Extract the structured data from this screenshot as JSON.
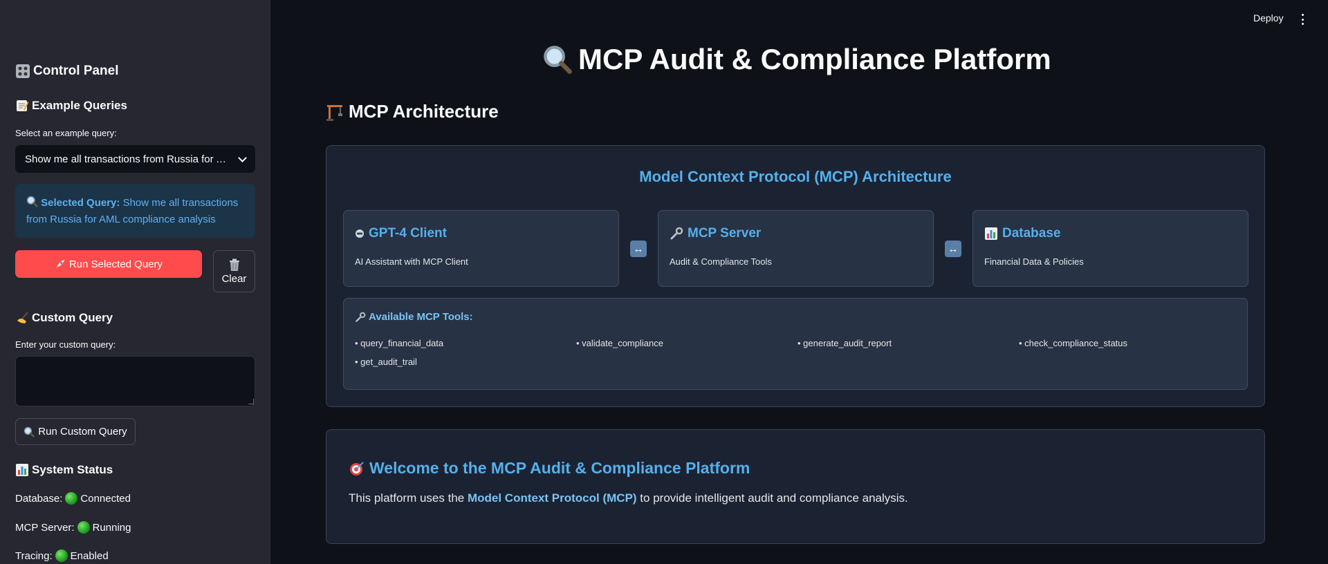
{
  "header": {
    "deploy_label": "Deploy"
  },
  "sidebar": {
    "control_panel_title": "Control Panel",
    "example_queries_title": "Example Queries",
    "select_label": "Select an example query:",
    "selected_example": "Show me all transactions from Russia for AML compliance analysis",
    "selected_query_label": "Selected Query:",
    "selected_query_text": "Show me all transactions from Russia for AML compliance analysis",
    "run_selected_label": "Run Selected Query",
    "clear_label": "Clear",
    "custom_query_title": "Custom Query",
    "custom_query_label": "Enter your custom query:",
    "custom_query_value": "",
    "run_custom_label": "Run Custom Query",
    "system_status_title": "System Status",
    "status": [
      {
        "label": "Database:",
        "value": "Connected",
        "color": "#1fa01f"
      },
      {
        "label": "MCP Server:",
        "value": "Running",
        "color": "#1fa01f"
      },
      {
        "label": "Tracing:",
        "value": "Enabled",
        "color": "#1fa01f"
      }
    ]
  },
  "main": {
    "title": "MCP Audit & Compliance Platform",
    "architecture_title": "MCP Architecture",
    "architecture_box_title": "Model Context Protocol (MCP) Architecture",
    "components": [
      {
        "title": "GPT-4 Client",
        "desc": "AI Assistant with MCP Client",
        "icon": "robot-icon"
      },
      {
        "title": "MCP Server",
        "desc": "Audit & Compliance Tools",
        "icon": "wrench-icon"
      },
      {
        "title": "Database",
        "desc": "Financial Data & Policies",
        "icon": "bar-chart-icon"
      }
    ],
    "tools_title": "Available MCP Tools:",
    "tools": [
      "• query_financial_data",
      "• validate_compliance",
      "• generate_audit_report",
      "• check_compliance_status",
      "• get_audit_trail"
    ],
    "welcome_title": "Welcome to the MCP Audit & Compliance Platform",
    "welcome_prefix": "This platform uses the ",
    "welcome_bold": "Model Context Protocol (MCP)",
    "welcome_suffix": " to provide intelligent audit and compliance analysis."
  },
  "colors": {
    "accent_blue": "#55b0ec",
    "primary_red": "#ff4b4b",
    "status_green": "#1fa01f",
    "background": "#0e1117",
    "sidebar_bg": "#262730"
  }
}
